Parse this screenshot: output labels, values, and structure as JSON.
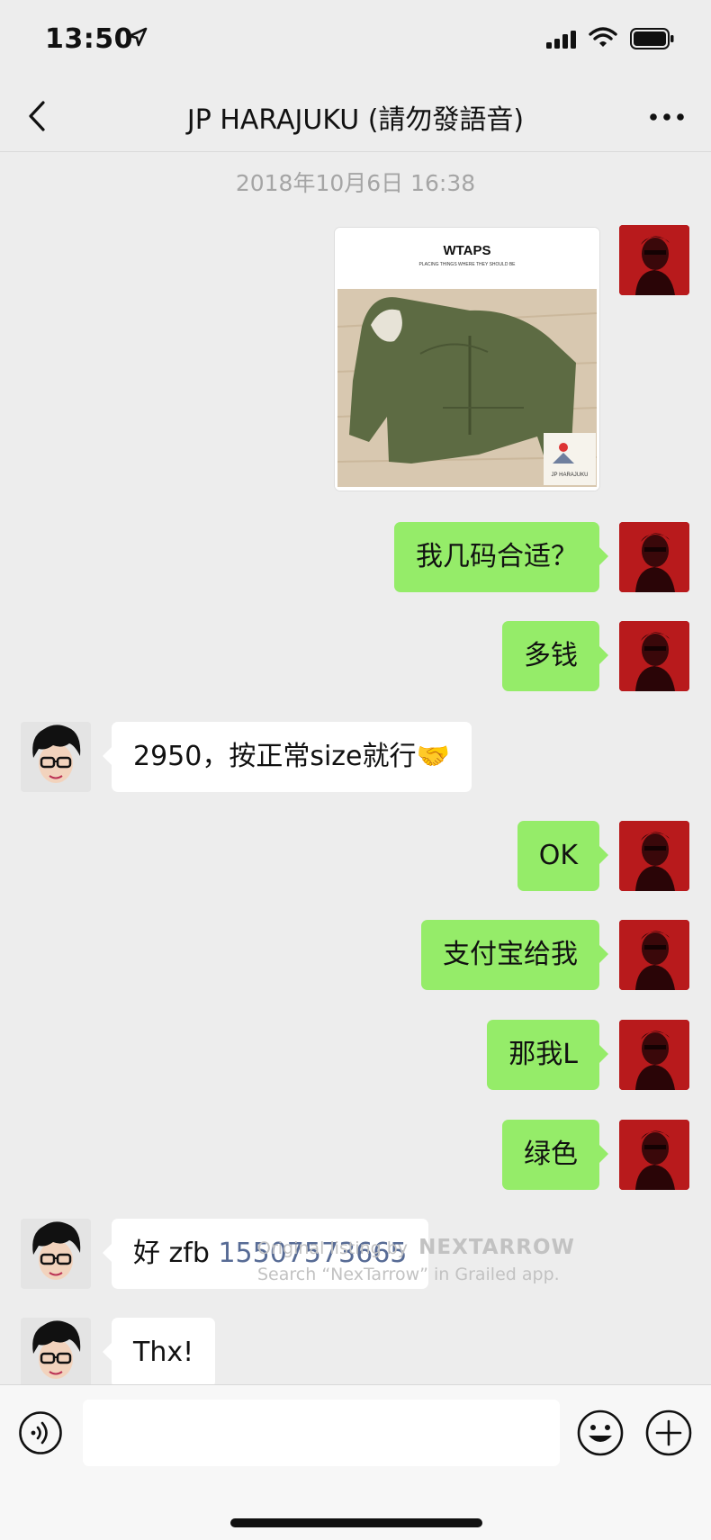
{
  "status_bar": {
    "time": "13:50"
  },
  "nav": {
    "title": "JP HARAJUKU (請勿發語音)"
  },
  "chat": {
    "timestamp": "2018年10月6日 16:38",
    "image_message": {
      "brand": "WTAPS",
      "tagline": "PLACING THINGS WHERE THEY SHOULD BE",
      "logo_text": "JP HARAJUKU"
    },
    "messages": [
      {
        "sender": "me",
        "text": "我几码合适？"
      },
      {
        "sender": "me",
        "text": "多钱"
      },
      {
        "sender": "them",
        "text": "2950，按正常size就行",
        "emoji": "🤝"
      },
      {
        "sender": "me",
        "text": "OK"
      },
      {
        "sender": "me",
        "text": "支付宝给我"
      },
      {
        "sender": "me",
        "text": "那我L"
      },
      {
        "sender": "me",
        "text": "绿色"
      },
      {
        "sender": "them",
        "text": "好 zfb",
        "link": "15507573665"
      },
      {
        "sender": "them",
        "text": "Thx!"
      }
    ]
  },
  "watermark": {
    "line1": "Original listing by",
    "brand": "NEXTARROW",
    "line2": "Search “NexTarrow” in Grailed app."
  },
  "colors": {
    "my_bubble": "#95ec69",
    "their_bubble": "#ffffff",
    "background": "#ededed",
    "link": "#576b95"
  },
  "icons": [
    "location-arrow-icon",
    "signal-icon",
    "wifi-icon",
    "battery-icon",
    "back-chevron-icon",
    "more-dots-icon",
    "voice-icon",
    "emoji-icon",
    "plus-icon"
  ]
}
